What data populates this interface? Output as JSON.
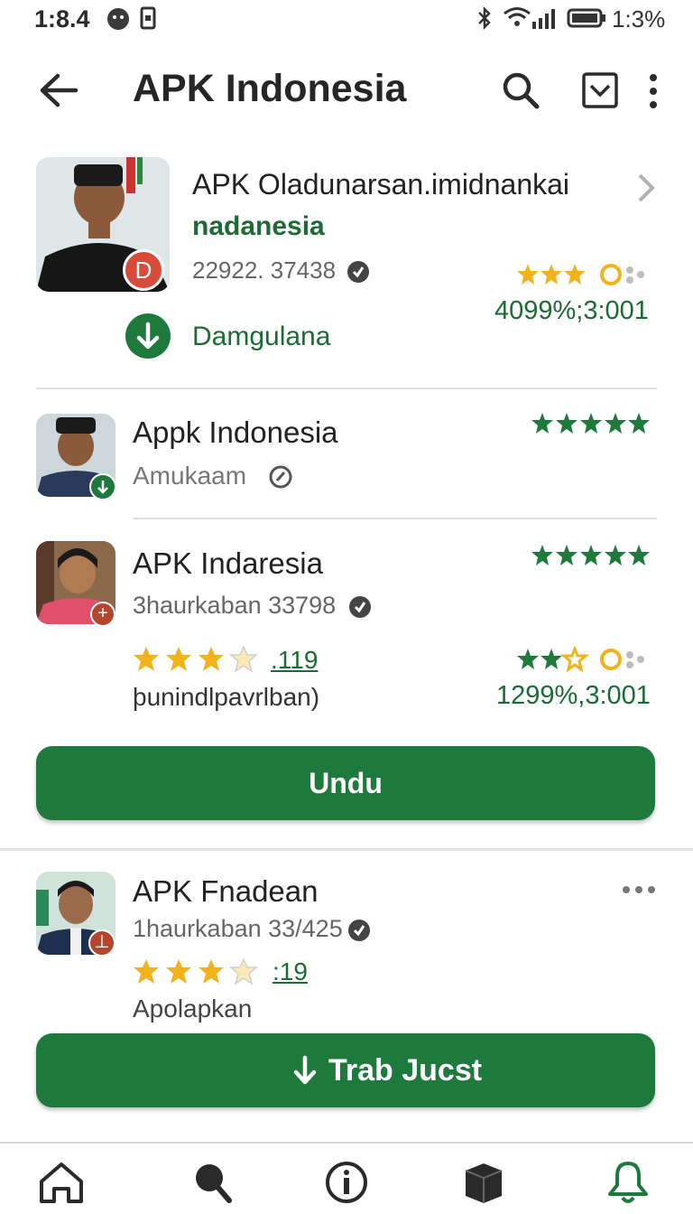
{
  "status_bar": {
    "time": "1:8.4",
    "battery_time": "1:3%"
  },
  "app_bar": {
    "title": "APK Indonesia"
  },
  "featured": {
    "title": "APK Oladunarsan.imidnankai",
    "subtitle": "nadanesia",
    "meta": "22922. 37438",
    "avatar_badge": "D",
    "rating_text": "4099%;3:001",
    "action_label": "Damgulana"
  },
  "items": [
    {
      "title": "Appk Indonesia",
      "meta": "Amukaam"
    },
    {
      "title": "APK Indaresia",
      "meta": "3haurkaban 33798",
      "rating_count": ".119",
      "description": "þunindlpavrlban)",
      "rating_text": "1299%,3:001"
    },
    {
      "title": "APK Fnadean",
      "meta": "1haurkaban 33/425",
      "rating_count": ":19",
      "description": "Apolapkan"
    }
  ],
  "buttons": {
    "primary": "Undu",
    "secondary": "Trab Jucst"
  },
  "bottom_nav": [
    "home-icon",
    "search-icon",
    "info-icon",
    "box-icon",
    "bell-icon"
  ],
  "colors": {
    "accent": "#1d7a3c",
    "star": "#f2b21c"
  }
}
